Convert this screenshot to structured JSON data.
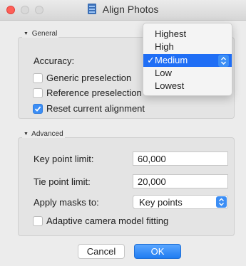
{
  "window": {
    "title": "Align Photos"
  },
  "general": {
    "heading": "General",
    "accuracy_label": "Accuracy:",
    "accuracy_options": [
      "Highest",
      "High",
      "Medium",
      "Low",
      "Lowest"
    ],
    "accuracy_selected": "Medium",
    "generic_preselection": "Generic preselection",
    "reference_preselection": "Reference preselection",
    "reset_alignment": "Reset current alignment"
  },
  "advanced": {
    "heading": "Advanced",
    "key_point_label": "Key point limit:",
    "key_point_value": "60,000",
    "tie_point_label": "Tie point limit:",
    "tie_point_value": "20,000",
    "masks_label": "Apply masks to:",
    "masks_value": "Key points",
    "adaptive_fitting": "Adaptive camera model fitting"
  },
  "buttons": {
    "cancel": "Cancel",
    "ok": "OK"
  },
  "colors": {
    "accent": "#1f6ef5",
    "close": "#fe5f57"
  }
}
